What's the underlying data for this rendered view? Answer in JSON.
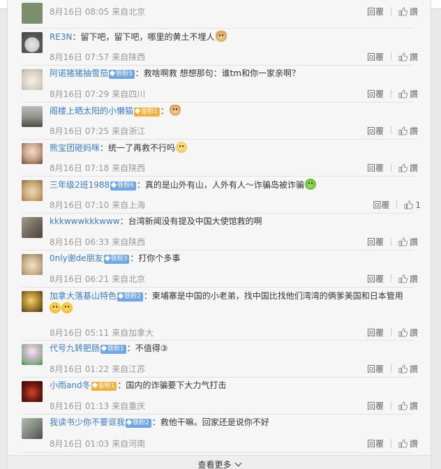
{
  "comments": [
    {
      "user": "",
      "badge": "",
      "text": "",
      "time": "8月16日 08:05 来自北京",
      "reply": "回覆",
      "like": "讚",
      "avatar": "#7a8f6a"
    },
    {
      "user": "RE3N",
      "badge": "",
      "text": "：留下吧，留下吧，哪里的黄土不埋人",
      "time": "8月16日 07:57 来自陕西",
      "reply": "回覆",
      "like": "讚",
      "avatar": "#8a8a8a"
    },
    {
      "user": "阿诺猪猪抽雪茄",
      "badge": "铁粉5",
      "text": "：救啥啊救 想想那句：谁tm和你一家亲啊？",
      "time": "8月16日 07:29 来自四川",
      "reply": "回覆",
      "like": "讚",
      "avatar": "#d8d1c8"
    },
    {
      "user": "阁楼上晒太阳的小懒猫",
      "badge": "金粉1",
      "text": "：",
      "time": "8月16日 07:25 来自浙江",
      "reply": "回覆",
      "like": "讚",
      "avatar": "#8d8f86"
    },
    {
      "user": "熊宝团砸妈咪",
      "badge": "",
      "text": "：统一了再救不行吗",
      "time": "8月16日 07:18 来自陕西",
      "reply": "回覆",
      "like": "讚",
      "avatar": "#b79e8b"
    },
    {
      "user": "三年级2班1988",
      "badge": "铁粉6",
      "text": "：真的是山外有山，人外有人～诈骗岛被诈骗",
      "time": "8月16日 07:10 来自上海",
      "reply": "回覆",
      "like": "讚",
      "count": "1",
      "avatar": "#c9b08a"
    },
    {
      "user": "kkkwwwkkkwww",
      "badge": "",
      "text": "：台湾新闻没有提及中国大使馆救的啊",
      "time": "8月16日 06:33 来自陕西",
      "reply": "回覆",
      "like": "讚",
      "avatar": "#847a6a"
    },
    {
      "user": "0nly谢de朋友",
      "badge": "铁粉3",
      "text": "：打你个多事",
      "time": "8月16日 06:21 来自北京",
      "reply": "回覆",
      "like": "讚",
      "avatar": "#a99a7e"
    },
    {
      "user": "加拿大落基山特色",
      "badge": "铁粉2",
      "text": "：柬埔寨是中国的小老弟，找中国比找他们湾湾的俩爹美国和日本管用",
      "time": "8月16日 05:11 来自加拿大",
      "reply": "回覆",
      "like": "讚",
      "avatar": "#6e5a44"
    },
    {
      "user": "代号九转肥肠",
      "badge": "铁粉1",
      "text": "：不值得③",
      "time": "8月16日 01:22 来自江苏",
      "reply": "回覆",
      "like": "讚",
      "avatar": "#9bb3a0"
    },
    {
      "user": "小雨and冬",
      "badge": "金粉1",
      "text": "：国内的诈骗要下大力气打击",
      "time": "8月16日 01:13 来自重庆",
      "reply": "回覆",
      "like": "讚",
      "avatar": "#5a1a10"
    },
    {
      "user": "我读书少你不要诓我",
      "badge": "铁粉2",
      "text": "：救他干嘛。回家还是说你不好",
      "time": "8月16日 01:03 来自河南",
      "reply": "回覆",
      "like": "讚",
      "avatar": "#8d8f8a"
    }
  ],
  "more_label": "查看更多"
}
